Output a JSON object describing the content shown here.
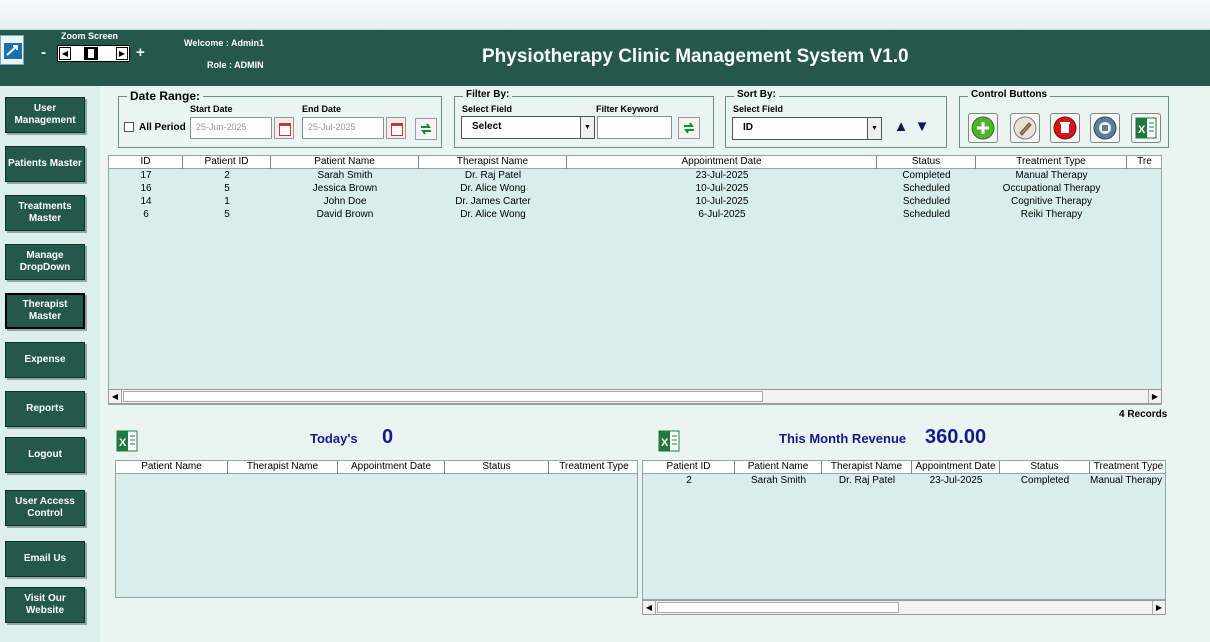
{
  "header": {
    "zoom_label": "Zoom Screen",
    "zoom_minus": "-",
    "zoom_plus": "+",
    "welcome_text": "Welcome :  Admin1",
    "role_text": "Role :  ADMIN",
    "title": "Physiotherapy Clinic Management System V1.0"
  },
  "sidebar": {
    "items": [
      {
        "label": "User Management"
      },
      {
        "label": "Patients Master"
      },
      {
        "label": "Treatments Master"
      },
      {
        "label": "Manage DropDown"
      },
      {
        "label": "Therapist Master"
      },
      {
        "label": "Expense"
      },
      {
        "label": "Reports"
      },
      {
        "label": "Logout"
      },
      {
        "label": "User Access Control"
      },
      {
        "label": "Email Us"
      },
      {
        "label": "Visit Our Website"
      }
    ]
  },
  "date_range": {
    "title": "Date Range:",
    "start_label": "Start Date",
    "end_label": "End Date",
    "all_period_label": "All Period",
    "start_value": "25-Jun-2025",
    "end_value": "25-Jul-2025"
  },
  "filter": {
    "title": "Filter By:",
    "field_label": "Select Field",
    "keyword_label": "Filter Keyword",
    "field_value": "Select",
    "keyword_value": ""
  },
  "sort": {
    "title": "Sort By:",
    "field_label": "Select Field",
    "field_value": "ID",
    "up": "▲",
    "down": "▼"
  },
  "controls": {
    "title": "Control Buttons"
  },
  "main_table": {
    "columns": [
      "ID",
      "Patient ID",
      "Patient Name",
      "Therapist Name",
      "Appointment Date",
      "Status",
      "Treatment Type",
      "Tre"
    ],
    "rows": [
      [
        "17",
        "2",
        "Sarah Smith",
        "Dr. Raj Patel",
        "23-Jul-2025",
        "Completed",
        "Manual Therapy"
      ],
      [
        "16",
        "5",
        "Jessica Brown",
        "Dr. Alice Wong",
        "10-Jul-2025",
        "Scheduled",
        "Occupational Therapy"
      ],
      [
        "14",
        "1",
        "John Doe",
        "Dr. James Carter",
        "10-Jul-2025",
        "Scheduled",
        "Cognitive Therapy"
      ],
      [
        "6",
        "5",
        "David Brown",
        "Dr. Alice Wong",
        "6-Jul-2025",
        "Scheduled",
        "Reiki Therapy"
      ]
    ],
    "records_text": "4 Records"
  },
  "today": {
    "label": "Today's",
    "value": "0",
    "columns": [
      "Patient Name",
      "Therapist Name",
      "Appointment Date",
      "Status",
      "Treatment Type"
    ]
  },
  "revenue": {
    "label": "This Month Revenue",
    "value": "360.00",
    "columns": [
      "Patient ID",
      "Patient Name",
      "Therapist Name",
      "Appointment Date",
      "Status",
      "Treatment Type"
    ],
    "rows": [
      [
        "2",
        "Sarah Smith",
        "Dr. Raj Patel",
        "23-Jul-2025",
        "Completed",
        "Manual Therapy"
      ]
    ]
  }
}
